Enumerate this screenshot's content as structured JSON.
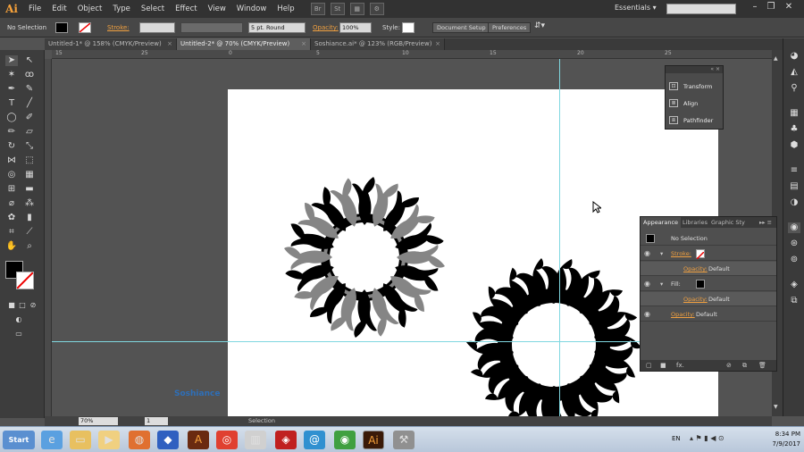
{
  "app": {
    "logo": "Ai"
  },
  "menu": [
    "File",
    "Edit",
    "Object",
    "Type",
    "Select",
    "Effect",
    "View",
    "Window",
    "Help"
  ],
  "menu_icons": [
    "Br",
    "St"
  ],
  "workspace": "Essentials",
  "control_bar": {
    "selection": "No Selection",
    "stroke_label": "Stroke:",
    "brush": "5 pt. Round",
    "opacity_label": "Opacity:",
    "opacity_value": "100%",
    "style_label": "Style:",
    "doc_setup": "Document Setup",
    "preferences": "Preferences"
  },
  "tabs": [
    {
      "label": "Untitled-1* @ 158% (CMYK/Preview)",
      "active": false
    },
    {
      "label": "Untitled-2* @ 70% (CMYK/Preview)",
      "active": true
    },
    {
      "label": "Soshiance.ai* @ 123% (RGB/Preview)",
      "active": false
    }
  ],
  "ruler_h": [
    "15",
    "25",
    "0",
    "5",
    "10",
    "15",
    "20",
    "25"
  ],
  "float_panel": {
    "items": [
      "Transform",
      "Align",
      "Pathfinder"
    ]
  },
  "appearance": {
    "tabs": [
      "Appearance",
      "Libraries",
      "Graphic Sty"
    ],
    "title": "No Selection",
    "stroke_label": "Stroke:",
    "opacity_label": "Opacity:",
    "default": "Default",
    "fill_label": "Fill:",
    "fx": "fx."
  },
  "status": {
    "zoom": "70%",
    "page": "1",
    "tool": "Selection"
  },
  "taskbar": {
    "start": "Start",
    "lang": "EN",
    "time": "8:34 PM",
    "date": "7/9/2017"
  },
  "watermark": "Soshiance"
}
